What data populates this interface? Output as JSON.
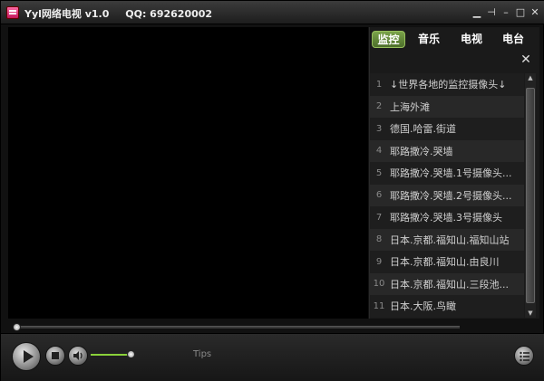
{
  "app": {
    "title": "Yyl网络电视 v1.0",
    "qq": "QQ: 692620002"
  },
  "window_controls": {
    "min": "▁",
    "pin": "⊣",
    "minimize": "–",
    "maximize": "□",
    "close": "✕"
  },
  "tabs": [
    {
      "label": "监控",
      "active": true
    },
    {
      "label": "音乐",
      "active": false
    },
    {
      "label": "电视",
      "active": false
    },
    {
      "label": "电台",
      "active": false
    }
  ],
  "panel": {
    "close": "✕"
  },
  "channels": [
    {
      "num": "1",
      "label": "↓世界各地的监控摄像头↓"
    },
    {
      "num": "2",
      "label": "上海外滩"
    },
    {
      "num": "3",
      "label": "德国.哈雷.街道"
    },
    {
      "num": "4",
      "label": "耶路撒冷.哭墙"
    },
    {
      "num": "5",
      "label": "耶路撒冷.哭墙.1号摄像头..."
    },
    {
      "num": "6",
      "label": "耶路撒冷.哭墙.2号摄像头..."
    },
    {
      "num": "7",
      "label": "耶路撒冷.哭墙.3号摄像头"
    },
    {
      "num": "8",
      "label": "日本.京都.福知山.福知山站"
    },
    {
      "num": "9",
      "label": "日本.京都.福知山.由良川"
    },
    {
      "num": "10",
      "label": "日本.京都.福知山.三段池..."
    },
    {
      "num": "11",
      "label": "日本.大阪.鸟瞰"
    }
  ],
  "scrollbar": {
    "up": "▲",
    "down": "▼"
  },
  "player": {
    "seek_progress": 0.0,
    "volume": 0.95,
    "tips": "Tips"
  },
  "colors": {
    "active_tab": "#6a9140",
    "volume_fill": "#8ad13a"
  }
}
